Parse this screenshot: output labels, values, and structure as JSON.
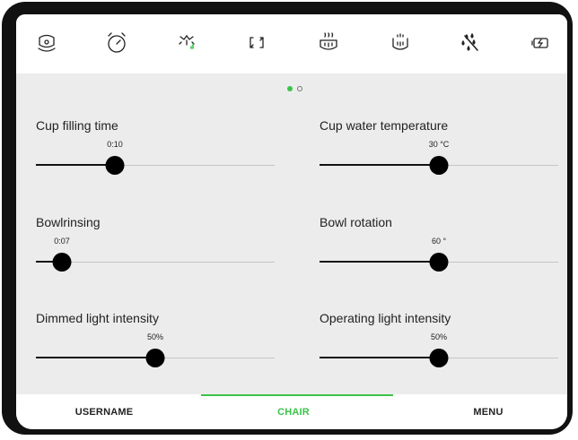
{
  "toolbar": {
    "icons": [
      "patient-head-icon",
      "timer-icon",
      "light-intensity-icon",
      "fullscreen-brackets-icon",
      "warm-basin-icon",
      "basin-icon",
      "water-drops-icon",
      "battery-charging-icon"
    ]
  },
  "pager": {
    "pages": 2,
    "current": 1
  },
  "settings": {
    "cup_filling_time": {
      "label": "Cup filling time",
      "value": "0:10",
      "level": 0.33
    },
    "cup_water_temperature": {
      "label": "Cup water temperature",
      "value": "30 °C",
      "level": 0.5
    },
    "bowlrinsing": {
      "label": "Bowlrinsing",
      "value": "0:07",
      "level": 0.11
    },
    "bowl_rotation": {
      "label": "Bowl rotation",
      "value": "60 °",
      "level": 0.5
    },
    "dimmed_light_intensity": {
      "label": "Dimmed light intensity",
      "value": "50%",
      "level": 0.5
    },
    "operating_light_intensity": {
      "label": "Operating light intensity",
      "value": "50%",
      "level": 0.5
    }
  },
  "tabs": {
    "username": "USERNAME",
    "chair": "CHAIR",
    "menu": "MENU",
    "active": "chair"
  },
  "colors": {
    "accent": "#3cc34a",
    "content_background": "#ececec",
    "device_frame": "#111111"
  }
}
